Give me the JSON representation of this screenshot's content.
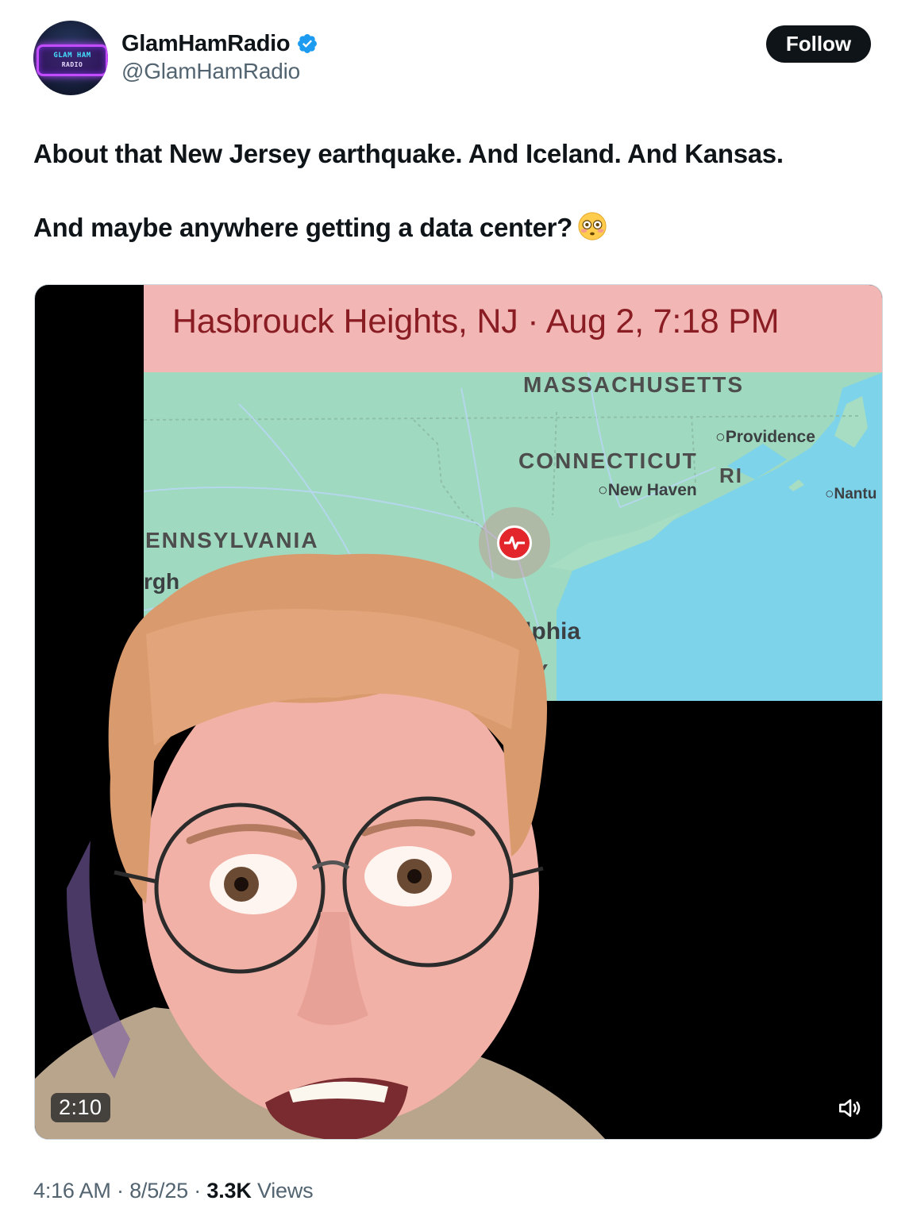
{
  "author": {
    "display_name": "GlamHamRadio",
    "handle": "@GlamHamRadio",
    "verified": true,
    "avatar_text_line1": "GLAM HAM",
    "avatar_text_line2": "RADIO"
  },
  "follow_label": "Follow",
  "tweet": {
    "line1": "About that New Jersey earthquake. And Iceland. And Kansas.",
    "line2": "And maybe anywhere getting a data center?",
    "emoji": "flushed-face"
  },
  "video": {
    "banner": "Hasbrouck Heights, NJ · Aug 2, 7:18 PM",
    "duration": "2:10",
    "map_labels": {
      "massachusetts": "MASSACHUSETTS",
      "connecticut": "CONNECTICUT",
      "ri": "RI",
      "pennsylvania": "ENNSYLVANIA",
      "pittsburgh": "rgh",
      "philadelphia": "ladelphia",
      "jersey": "EY",
      "providence": "Providence",
      "new_haven": "New Haven",
      "nantucket": "Nantu"
    }
  },
  "meta": {
    "time": "4:16 AM",
    "date": "8/5/25",
    "views_count": "3.3K",
    "views_label": "Views",
    "separator": "·"
  },
  "colors": {
    "verified": "#1d9bf0",
    "banner_bg": "#f2b6b4",
    "banner_text": "#8a1d24",
    "ocean": "#7dd3ea",
    "land": "#9fd9bf"
  }
}
